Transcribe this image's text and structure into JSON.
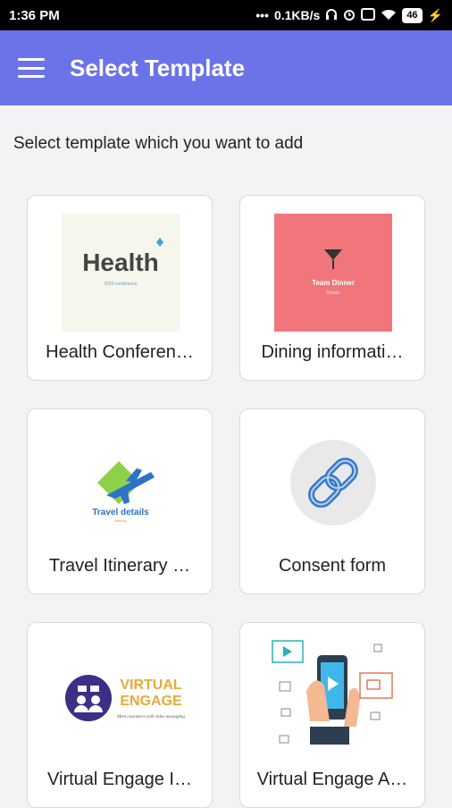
{
  "status_bar": {
    "time": "1:36 PM",
    "net_speed": "0.1KB/s",
    "battery": "46"
  },
  "app_bar": {
    "title": "Select Template"
  },
  "subtitle": "Select template which you want to add",
  "templates": [
    {
      "label": "Health Conferen…",
      "thumb_text": "Health",
      "thumb_sub": "2020 conference"
    },
    {
      "label": "Dining informati…",
      "thumb_text": "Team Dinner",
      "thumb_sub": "Details"
    },
    {
      "label": "Travel Itinerary …",
      "thumb_text": "Travel details",
      "thumb_sub": "itinerary"
    },
    {
      "label": "Consent form"
    },
    {
      "label": "Virtual Engage I…",
      "thumb_text": "VIRTUAL",
      "thumb_text2": "ENGAGE",
      "thumb_sub": "Meet customers with video messaging"
    },
    {
      "label": "Virtual Engage A…"
    }
  ],
  "colors": {
    "app_bar": "#6c73e8",
    "dining_bg": "#f0767c",
    "health_bg": "#f6f6ec"
  }
}
